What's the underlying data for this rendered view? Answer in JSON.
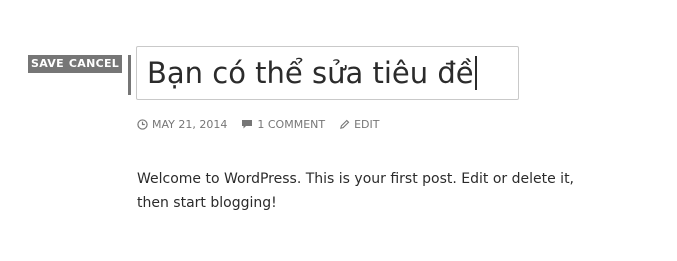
{
  "controls": {
    "save_label": "SAVE",
    "cancel_label": "CANCEL"
  },
  "post": {
    "title": "Bạn có thể sửa tiêu đề",
    "meta": {
      "date": "MAY 21, 2014",
      "comments": "1 COMMENT",
      "edit": "EDIT"
    },
    "content": "Welcome to WordPress. This is your first post. Edit or delete it, then start blogging!"
  },
  "icons": {
    "date": "clock-icon",
    "comments": "speech-bubble-icon",
    "edit": "pencil-icon"
  },
  "colors": {
    "controls_bg": "#767676",
    "meta_text": "#767676",
    "text": "#2b2b2b"
  }
}
